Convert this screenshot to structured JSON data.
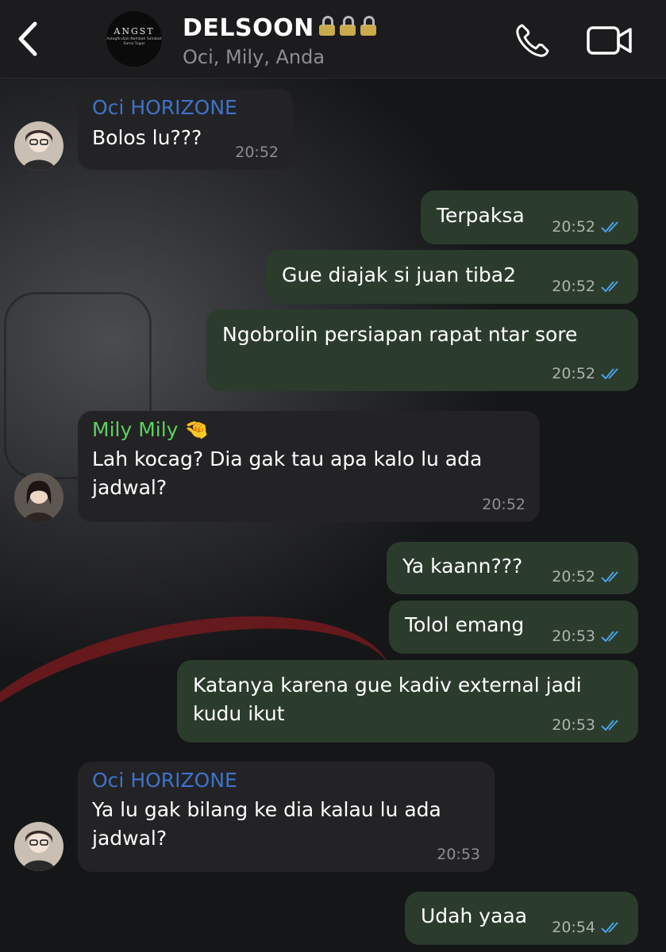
{
  "header": {
    "group_avatar_text": "ANGST",
    "group_avatar_subtext": "Astagfirullah Nambah Sahabat Sama Tugas",
    "title": "DELSOON",
    "members": "Oci, Mily, Anda"
  },
  "colors": {
    "outgoing_bubble": "#2b3b2c",
    "incoming_bubble": "#232325",
    "sender_oci": "#3f72c9",
    "sender_mily": "#5bd15d",
    "read_ticks": "#4aa3e8"
  },
  "messages": [
    {
      "dir": "in",
      "sender": "Oci HORIZONE",
      "text": "Bolos lu???",
      "time": "20:52"
    },
    {
      "dir": "out",
      "text": "Terpaksa",
      "time": "20:52"
    },
    {
      "dir": "out",
      "text": "Gue diajak si juan tiba2",
      "time": "20:52"
    },
    {
      "dir": "out",
      "text": "Ngobrolin persiapan rapat ntar sore",
      "time": "20:52"
    },
    {
      "dir": "in",
      "sender": "Mily Mily 🤏",
      "text": "Lah kocag? Dia gak tau apa kalo lu ada jadwal?",
      "time": "20:52"
    },
    {
      "dir": "out",
      "text": "Ya kaann???",
      "time": "20:52"
    },
    {
      "dir": "out",
      "text": "Tolol emang",
      "time": "20:53"
    },
    {
      "dir": "out",
      "text": "Katanya karena gue kadiv external jadi kudu ikut",
      "time": "20:53"
    },
    {
      "dir": "in",
      "sender": "Oci HORIZONE",
      "text": "Ya lu gak bilang ke dia kalau lu ada jadwal?",
      "time": "20:53"
    },
    {
      "dir": "out",
      "text": "Udah yaaa",
      "time": "20:54"
    }
  ]
}
